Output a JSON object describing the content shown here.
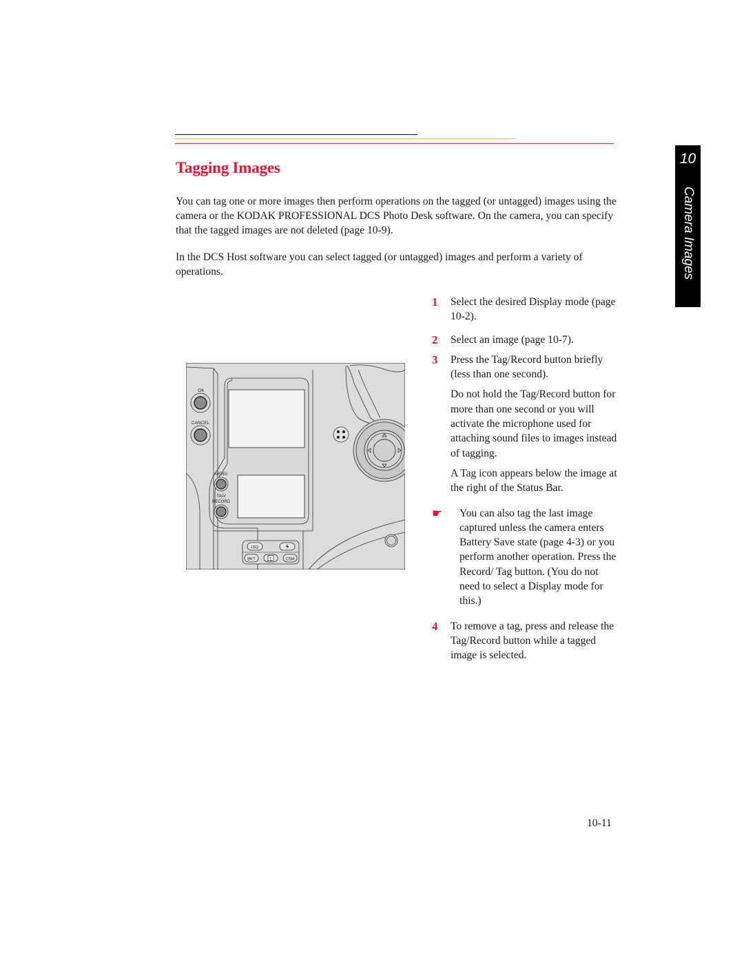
{
  "page": {
    "heading": "Tagging Images",
    "colors": {
      "accent_red": "#ee1133",
      "rule_black": "#111111",
      "rule_gold": "#f7b955",
      "rule_red": "#ee1c3c",
      "tab_background": "#000000"
    },
    "side_tab": {
      "chapter_number": "10",
      "chapter_title": "Camera Images"
    },
    "intro_paragraphs": [
      "You can tag one or more images then perform operations on the tagged (or untagged) images using the camera or the KODAK PROFESSIONAL DCS Photo Desk software. On the camera, you can specify that the tagged images are not deleted (page 10-9).",
      "In the DCS Host software you can select tagged (or untagged) images and perform a variety of operations."
    ],
    "steps": [
      {
        "number": "1",
        "text": "Select the desired Display mode (page 10-2)."
      },
      {
        "number": "2",
        "text": "Select an image (page 10-7)."
      },
      {
        "number": "3",
        "text": "Press the Tag/Record button briefly (less than one second)."
      },
      {
        "number": "4",
        "text": "To remove a tag, press and release the Tag/Record button while a tagged image is selected."
      }
    ],
    "step3_notes": [
      "Do not hold the Tag/Record button for more than one second or you will activate the microphone used for attaching sound files to images instead of tagging.",
      "A Tag icon appears below the image at the right of the Status Bar."
    ],
    "tip": {
      "icon": "pointing-hand-icon",
      "glyph": "☛",
      "text": "You can also tag the last image captured unless the camera enters Battery Save state (page 4-3) or you perform another operation. Press the Record/ Tag button. (You do not need to select a Display mode for this.)"
    },
    "figure": {
      "labels": {
        "ok": "OK",
        "cancel": "CANCEL",
        "menu": "MENU",
        "tag": "TAG/",
        "record": "RECORD",
        "iso": "ISO",
        "bkt": "BKT",
        "csm": "CSM",
        "l": "L"
      }
    },
    "page_number": "10-11"
  }
}
